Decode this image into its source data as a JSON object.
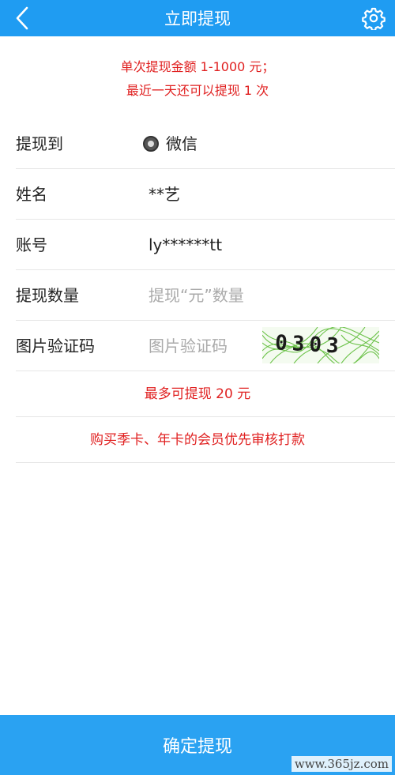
{
  "header": {
    "title": "立即提现",
    "back_icon": "chevron-left-icon",
    "settings_icon": "gear-icon"
  },
  "notice": {
    "line1": "单次提现金额 1-1000 元；",
    "line2": "最近一天还可以提现 1 次"
  },
  "form": {
    "withdraw_to": {
      "label": "提现到",
      "option": "微信"
    },
    "name": {
      "label": "姓名",
      "value": "**艺"
    },
    "account": {
      "label": "账号",
      "value": "ly******tt"
    },
    "amount": {
      "label": "提现数量",
      "placeholder": "提现“元”数量"
    },
    "captcha": {
      "label": "图片验证码",
      "placeholder": "图片验证码",
      "code": "0303"
    }
  },
  "info": {
    "max": "最多可提现 20 元",
    "priority": "购买季卡、年卡的会员优先审核打款"
  },
  "footer": {
    "submit_label": "确定提现"
  },
  "watermark": "www.365jz.com",
  "colors": {
    "header_bg": "#1f9cf2",
    "accent_red": "#e02020",
    "button_bg": "#2aa2f2"
  }
}
